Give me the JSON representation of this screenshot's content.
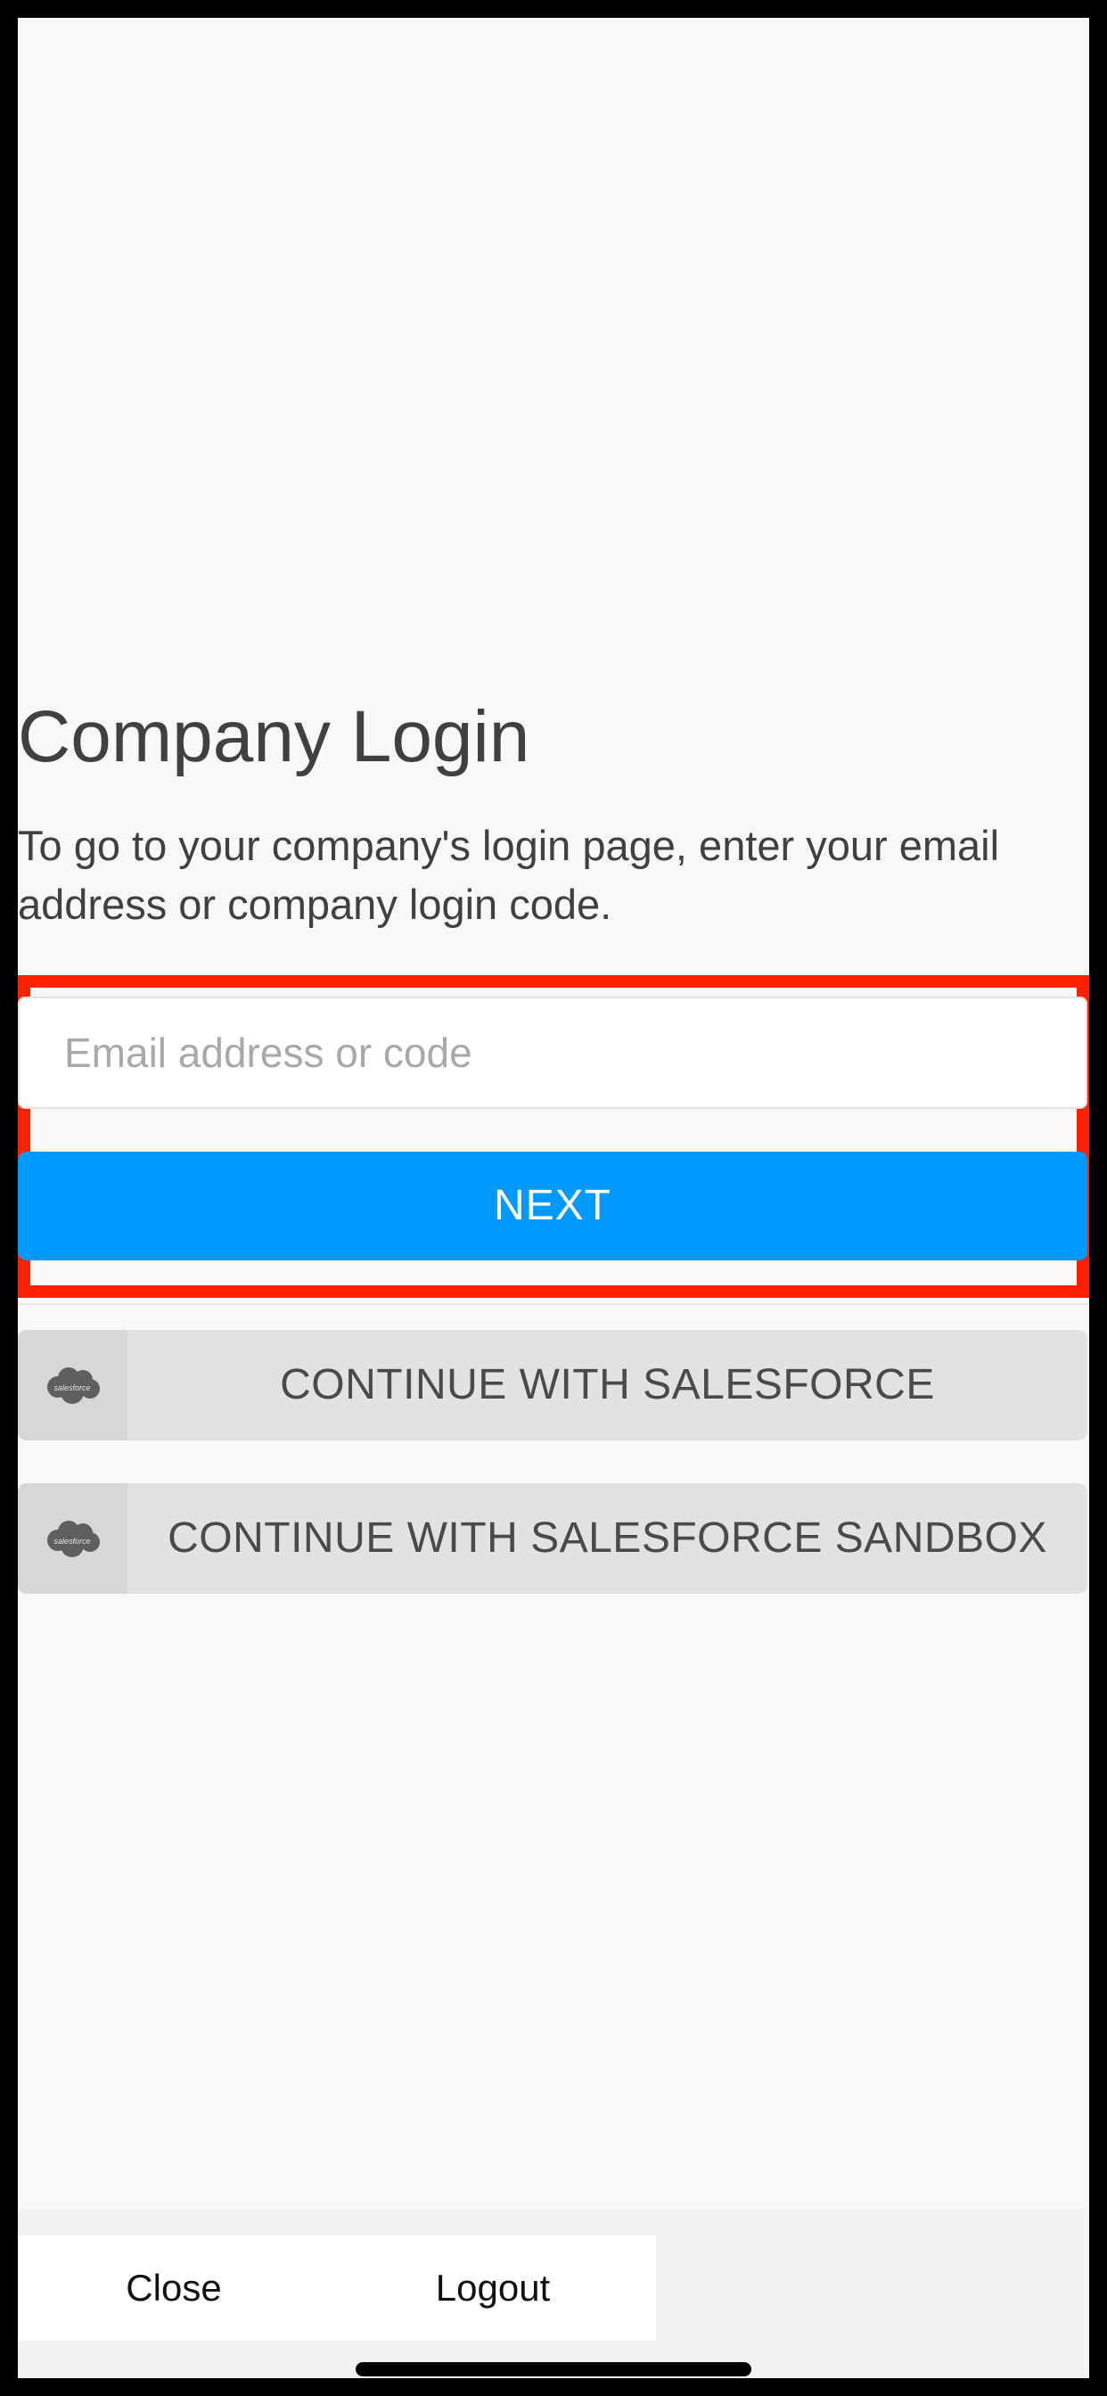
{
  "page": {
    "title": "Company Login",
    "description": "To go to your company's login page, enter your email address or company login code."
  },
  "form": {
    "email_placeholder": "Email address or code",
    "email_value": "",
    "next_label": "NEXT"
  },
  "sso": {
    "salesforce_label": "CONTINUE WITH SALESFORCE",
    "salesforce_sandbox_label": "CONTINUE WITH SALESFORCE SANDBOX",
    "icon": "salesforce-cloud-icon",
    "icon_text": "salesforce"
  },
  "bottom_bar": {
    "close_label": "Close",
    "logout_label": "Logout"
  },
  "colors": {
    "primary": "#0099ff",
    "highlight": "#ff2200",
    "sso_button_bg": "#e1e2e3",
    "text": "#404040"
  }
}
